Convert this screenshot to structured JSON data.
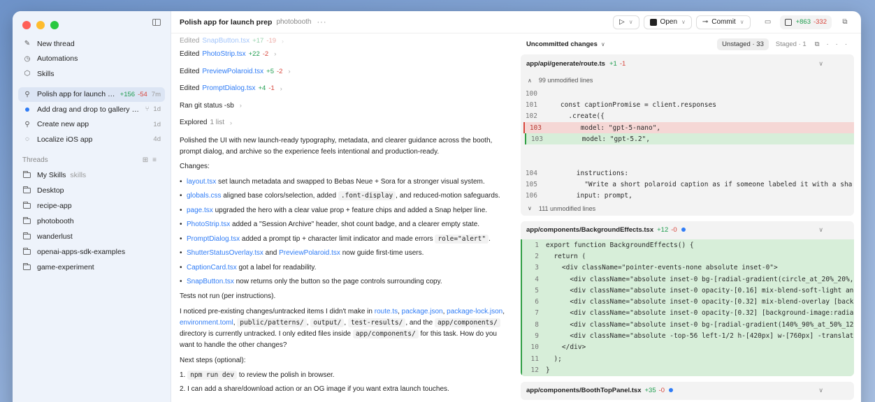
{
  "sidebar": {
    "nav": [
      {
        "label": "New thread",
        "icon": "compose-icon"
      },
      {
        "label": "Automations",
        "icon": "clock-icon"
      },
      {
        "label": "Skills",
        "icon": "cube-icon"
      }
    ],
    "recent": [
      {
        "title": "Polish app for launch prep",
        "add": "+156",
        "del": "-54",
        "time": "7m",
        "active": true
      },
      {
        "title": "Add drag and drop to gallery phot...",
        "time": "1d",
        "dot": true
      },
      {
        "title": "Create new app",
        "time": "1d"
      },
      {
        "title": "Localize iOS app",
        "time": "4d"
      }
    ],
    "threads_label": "Threads",
    "folders": [
      {
        "name": "My Skills",
        "sub": "skills"
      },
      {
        "name": "Desktop"
      },
      {
        "name": "recipe-app"
      },
      {
        "name": "photobooth"
      },
      {
        "name": "wanderlust"
      },
      {
        "name": "openai-apps-sdk-examples"
      },
      {
        "name": "game-experiment"
      }
    ]
  },
  "header": {
    "title": "Polish app for launch prep",
    "project": "photobooth",
    "open_label": "Open",
    "commit_label": "Commit",
    "diff_add": "+863",
    "diff_del": "-332"
  },
  "chat": {
    "edits": [
      {
        "verb": "Edited",
        "file": "SnapButton.tsx",
        "add": "+17",
        "del": "-19"
      },
      {
        "verb": "Edited",
        "file": "PhotoStrip.tsx",
        "add": "+22",
        "del": "-2"
      },
      {
        "verb": "Edited",
        "file": "PreviewPolaroid.tsx",
        "add": "+5",
        "del": "-2"
      },
      {
        "verb": "Edited",
        "file": "PromptDialog.tsx",
        "add": "+4",
        "del": "-1"
      }
    ],
    "ran": "Ran git status -sb",
    "explored": "Explored",
    "explored_count": "1 list",
    "summary": "Polished the UI with new launch-ready typography, metadata, and clearer guidance across the booth, prompt dialog, and archive so the experience feels intentional and production-ready.",
    "changes_label": "Changes:",
    "bullets": [
      {
        "file": "layout.tsx",
        "text": " set launch metadata and swapped to Bebas Neue + Sora for a stronger visual system."
      },
      {
        "file": "globals.css",
        "text": " aligned base colors/selection, added ",
        "code": ".font-display",
        "text2": ", and reduced-motion safeguards."
      },
      {
        "file": "page.tsx",
        "text": " upgraded the hero with a clear value prop + feature chips and added a Snap helper line."
      },
      {
        "file": "PhotoStrip.tsx",
        "text": " added a \"Session Archive\" header, shot count badge, and a clearer empty state."
      },
      {
        "file": "PromptDialog.tsx",
        "text": " added a prompt tip + character limit indicator and made errors ",
        "code": "role=\"alert\"",
        "text2": "."
      },
      {
        "file": "ShutterStatusOverlay.tsx",
        "text": " and ",
        "file2": "PreviewPolaroid.tsx",
        "text2": " now guide first-time users."
      },
      {
        "file": "CaptionCard.tsx",
        "text": " got a label for readability."
      },
      {
        "file": "SnapButton.tsx",
        "text": " now returns only the button so the page controls surrounding copy."
      }
    ],
    "tests": "Tests not run (per instructions).",
    "notice": {
      "p1": "I noticed pre-existing changes/untracked items I didn't make in ",
      "l1": "route.ts",
      "c1": ", ",
      "l2": "package.json",
      "c2": ", ",
      "l3": "package-lock.json",
      "c3": ",",
      "l4": "environment.toml",
      "c4": ", ",
      "k1": "public/patterns/",
      "c5": ", ",
      "k2": "output/",
      "c6": ", ",
      "k3": "test-results/",
      "c7": ", and the ",
      "k4": "app/components/",
      "p2": " directory is currently untracked. I only edited files inside ",
      "k5": "app/components/",
      "p3": " for this task. How do you want to handle the other changes?"
    },
    "next_label": "Next steps (optional):",
    "steps": [
      {
        "n": "1.",
        "code": "npm run dev",
        "text": " to review the polish in browser."
      },
      {
        "n": "2.",
        "text": "I can add a share/download action or an OG image if you want extra launch touches."
      }
    ]
  },
  "diff": {
    "header": "Uncommitted changes",
    "unstaged": "Unstaged · 33",
    "staged": "Staged · 1",
    "files": [
      {
        "path": "app/api/generate/route.ts",
        "add": "+1",
        "del": "-1",
        "unmod_top": "99 unmodified lines",
        "lines": [
          {
            "n": "100",
            "type": "ctx",
            "text": ""
          },
          {
            "n": "101",
            "type": "ctx",
            "text": "    const captionPromise = client.responses"
          },
          {
            "n": "102",
            "type": "ctx",
            "text": "      .create({"
          },
          {
            "n": "103",
            "type": "del",
            "text": "        model: \"gpt-5-nano\","
          },
          {
            "n": "103",
            "type": "add",
            "text": "        model: \"gpt-5.2\","
          },
          {
            "n": "",
            "type": "ctx",
            "text": ""
          },
          {
            "n": "",
            "type": "ctx",
            "text": ""
          },
          {
            "n": "104",
            "type": "ctx",
            "text": "        instructions:"
          },
          {
            "n": "105",
            "type": "ctx",
            "text": "          \"Write a short polaroid caption as if someone labeled it with a sha"
          },
          {
            "n": "106",
            "type": "ctx",
            "text": "        input: prompt,"
          }
        ],
        "unmod_bottom": "111 unmodified lines"
      },
      {
        "path": "app/components/BackgroundEffects.tsx",
        "add": "+12",
        "del": "-0",
        "lines": [
          {
            "n": "1",
            "text": "export function BackgroundEffects() {"
          },
          {
            "n": "2",
            "text": "  return ("
          },
          {
            "n": "3",
            "text": "    <div className=\"pointer-events-none absolute inset-0\">"
          },
          {
            "n": "4",
            "text": "      <div className=\"absolute inset-0 bg-[radial-gradient(circle_at_20%_20%,"
          },
          {
            "n": "5",
            "text": "      <div className=\"absolute inset-0 opacity-[0.16] mix-blend-soft-light an"
          },
          {
            "n": "6",
            "text": "      <div className=\"absolute inset-0 opacity-[0.32] mix-blend-overlay [back"
          },
          {
            "n": "7",
            "text": "      <div className=\"absolute inset-0 opacity-[0.32] [background-image:radia"
          },
          {
            "n": "8",
            "text": "      <div className=\"absolute inset-0 bg-[radial-gradient(140%_90%_at_50%_12("
          },
          {
            "n": "9",
            "text": "      <div className=\"absolute -top-56 left-1/2 h-[420px] w-[760px] -translat"
          },
          {
            "n": "10",
            "text": "    </div>"
          },
          {
            "n": "11",
            "text": "  );"
          },
          {
            "n": "12",
            "text": "}"
          }
        ]
      },
      {
        "path": "app/components/BoothTopPanel.tsx",
        "add": "+35",
        "del": "-0"
      }
    ]
  },
  "colors": {
    "accent": "#2f7cf6",
    "add": "#1f9d4f",
    "del": "#d8463c",
    "sidebar_bg": "#eef3fb"
  }
}
